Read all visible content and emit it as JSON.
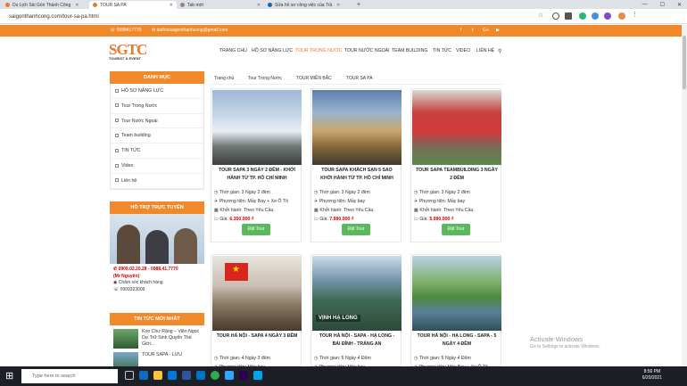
{
  "browser": {
    "tabs": [
      {
        "title": "Du Lịch Sài Gòn Thành Công"
      },
      {
        "title": "TOUR SA PA"
      },
      {
        "title": "Tab mới"
      },
      {
        "title": "Sửa hồ sơ công việc của Trầ"
      }
    ],
    "url": "saigonthanhcong.com/tour-sa-pa.html"
  },
  "topbar": {
    "phone": "0988417770",
    "email": "dathtosaigonthanhcong@gmail.com",
    "social": [
      "f",
      "t",
      "G+",
      "▶"
    ]
  },
  "logo": {
    "text": "SGTC",
    "sub": "TOURIST & EVENT"
  },
  "menu": [
    {
      "label": "TRANG CHỦ"
    },
    {
      "label": "HỒ SƠ NĂNG LỰC"
    },
    {
      "label": "TOUR TRONG NƯỚC"
    },
    {
      "label": "TOUR NƯỚC NGOÀI"
    },
    {
      "label": "TEAM BUILDING"
    },
    {
      "label": "TIN TỨC"
    },
    {
      "label": "VIDEO"
    },
    {
      "label": "LIÊN HỆ"
    }
  ],
  "breadcrumb": [
    "Trang chủ",
    "Tour Trong Nước",
    "TOUR MIỀN BẮC",
    "TOUR SA PA"
  ],
  "sidebar": {
    "title": "DANH MỤC",
    "items": [
      {
        "label": "HỒ SƠ NĂNG LỰC"
      },
      {
        "label": "Tour Trong Nước"
      },
      {
        "label": "Tour Nước Ngoài"
      },
      {
        "label": "Team building"
      },
      {
        "label": "TIN TỨC"
      },
      {
        "label": "Video"
      },
      {
        "label": "Liên hệ"
      }
    ]
  },
  "support": {
    "title": "HỖ TRỢ TRỰC TUYẾN",
    "phones": "0909.02.20.28 - 0988.41.7770",
    "contact_name": "(Mr Nguyên)",
    "care_label": "Chăm sóc khách hàng",
    "care_phone": "0909323009"
  },
  "news": {
    "title": "TIN TỨC MỚI NHẤT",
    "items": [
      {
        "title": "Kon Chư Răng – Viên Ngọc Dự Trữ Sinh Quyển Thế Giới..."
      },
      {
        "title": "TOUR SAPA - LƯU"
      }
    ]
  },
  "labels": {
    "time": "Thời gian:",
    "transport": "Phương tiện:",
    "depart": "Khởi hành:",
    "price": "Giá:",
    "book": "Đặt Tour"
  },
  "tours": [
    {
      "title": "TOUR SAPA 3 NGÀY 2 ĐÊM - KHỞI HÀNH TỪ TP. HỒ CHÍ MINH",
      "time": "3 Ngày 2 đêm",
      "transport": "Máy Bay + Xe Ô Tô",
      "depart": "Theo Yêu Cầu",
      "price": "6.350.000 ₫"
    },
    {
      "title": "TOUR SAPA KHÁCH SẠN 5 SAO KHỞI HÀNH TỪ TP. HỒ CHÍ MINH",
      "time": "3 Ngày 2 đêm",
      "transport": "Máy bay",
      "depart": "Theo Yêu Cầu",
      "price": "7.990.000 ₫"
    },
    {
      "title": "TOUR SAPA TEAMBUILDING 3 NGÀY 2 ĐÊM",
      "time": "3 Ngày 2 đêm",
      "transport": "Máy bay",
      "depart": "Theo Yêu Cầu",
      "price": "5.990.000 ₫"
    },
    {
      "title": "TOUR HÀ NỘI - SAPA 4 NGÀY 3 ĐÊM",
      "time": "4 Ngày 3 đêm",
      "transport": "Máy bay"
    },
    {
      "title": "TOUR HÀ NỘI - SAPA - HẠ LONG - BÁI ĐÍNH - TRÀNG AN",
      "time": "5 Ngày 4 Đêm",
      "transport": "Máy bay",
      "image_caption": "VỊNH HẠ LONG"
    },
    {
      "title": "TOUR HÀ NỘI - HẠ LONG - SAPA - 5 NGÀY 4 ĐÊM",
      "time": "5 Ngày 4 Đêm",
      "transport": "Máy Bay + Xe Ô Tô"
    }
  ],
  "os": {
    "search_placeholder": "Type here to search",
    "time": "8:56 PM",
    "date": "6/20/2021",
    "watermark_title": "Activate Windows",
    "watermark_sub": "Go to Settings to activate Windows."
  },
  "colors": {
    "brand": "#f0892a",
    "button": "#5cb85c",
    "price": "#cc0000"
  }
}
